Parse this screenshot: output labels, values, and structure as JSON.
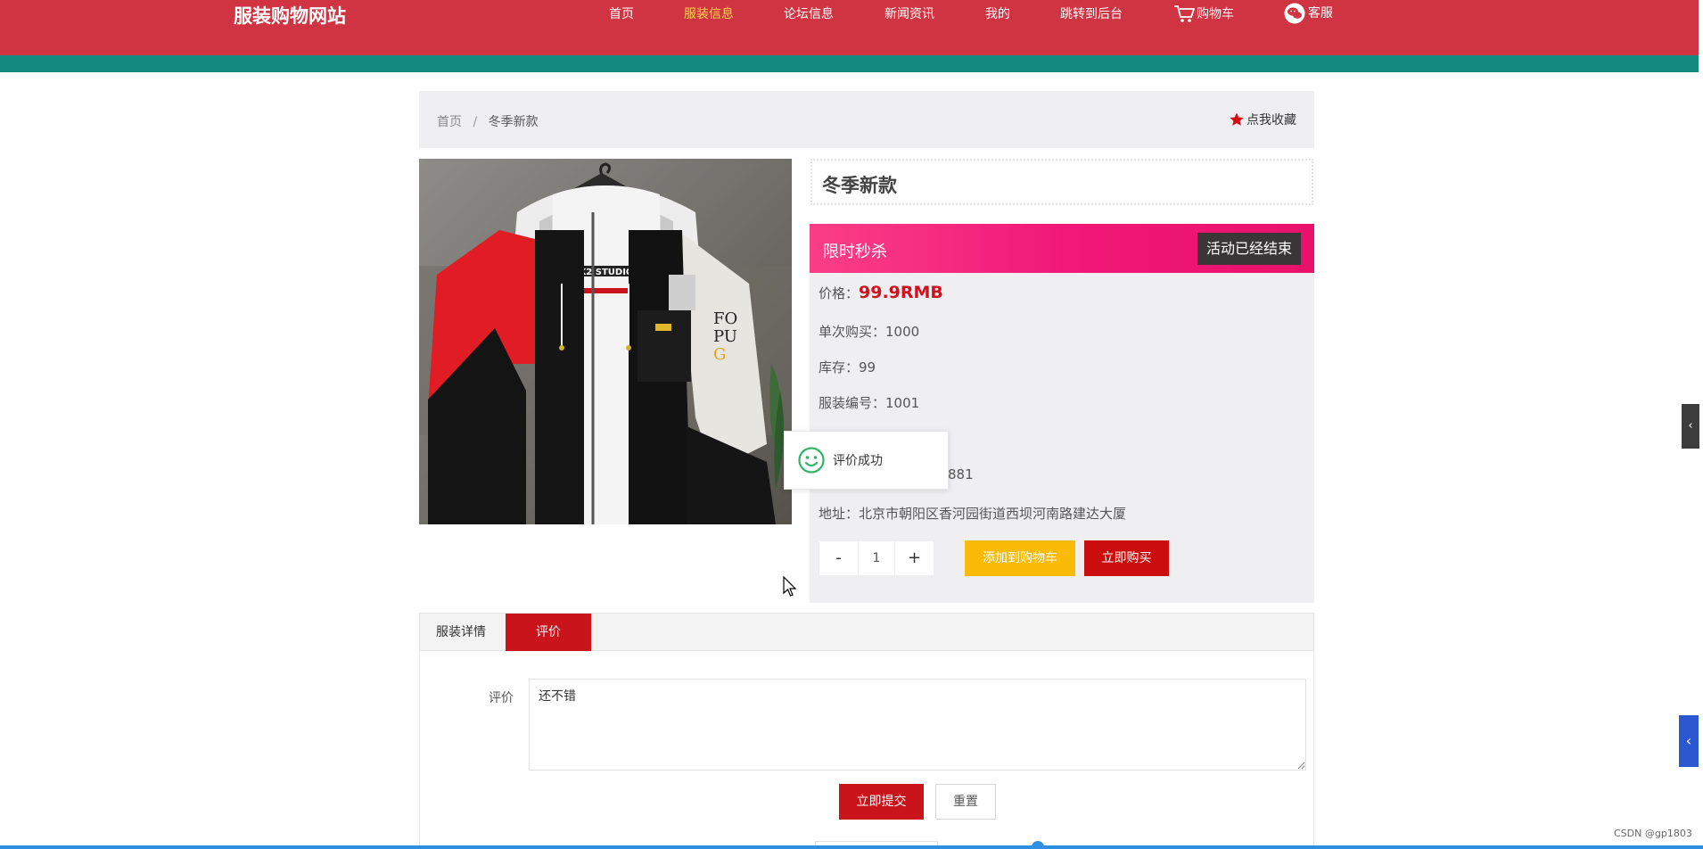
{
  "header": {
    "site_title": "服装购物网站",
    "nav": [
      {
        "label": "首页"
      },
      {
        "label": "服装信息"
      },
      {
        "label": "论坛信息"
      },
      {
        "label": "新闻资讯"
      },
      {
        "label": "我的"
      },
      {
        "label": "跳转到后台"
      },
      {
        "label": "购物车",
        "icon": "cart-icon"
      },
      {
        "label": "客服",
        "icon": "wechat-icon"
      }
    ],
    "active_nav": "服装信息"
  },
  "breadcrumb": {
    "home": "首页",
    "separator": "/",
    "current": "冬季新款"
  },
  "favorite_label": "点我收藏",
  "product": {
    "title": "冬季新款",
    "flash_sale_label": "限时秒杀",
    "flash_sale_status": "活动已经结束",
    "price_label": "价格：",
    "price_value": "99.9RMB",
    "single_buy_label": "单次购买：",
    "single_buy_value": "1000",
    "stock_label": "库存：",
    "stock_value": "99",
    "code_label": "服装编号：",
    "code_value": "1001",
    "partial_value": "881",
    "address_label": "地址：",
    "address_value": "北京市朝阳区香河园街道西坝河南路建达大厦"
  },
  "quantity": {
    "minus": "-",
    "value": "1",
    "plus": "+"
  },
  "actions": {
    "add_to_cart": "添加到购物车",
    "buy_now": "立即购买"
  },
  "toast": {
    "message": "评价成功"
  },
  "tabs": [
    {
      "label": "服装详情"
    },
    {
      "label": "评价"
    }
  ],
  "active_tab": "评价",
  "review_form": {
    "label": "评价",
    "value": "还不错",
    "submit": "立即提交",
    "reset": "重置"
  },
  "watermark": "CSDN @gp1803",
  "colors": {
    "header_red": "#d03341",
    "teal_band": "#138a7f",
    "active_nav": "#ffd54f",
    "flash_pink": "#f0197a",
    "price_red": "#d0121f",
    "cart_yellow": "#f9bb08",
    "buy_red": "#cc0d0d"
  }
}
